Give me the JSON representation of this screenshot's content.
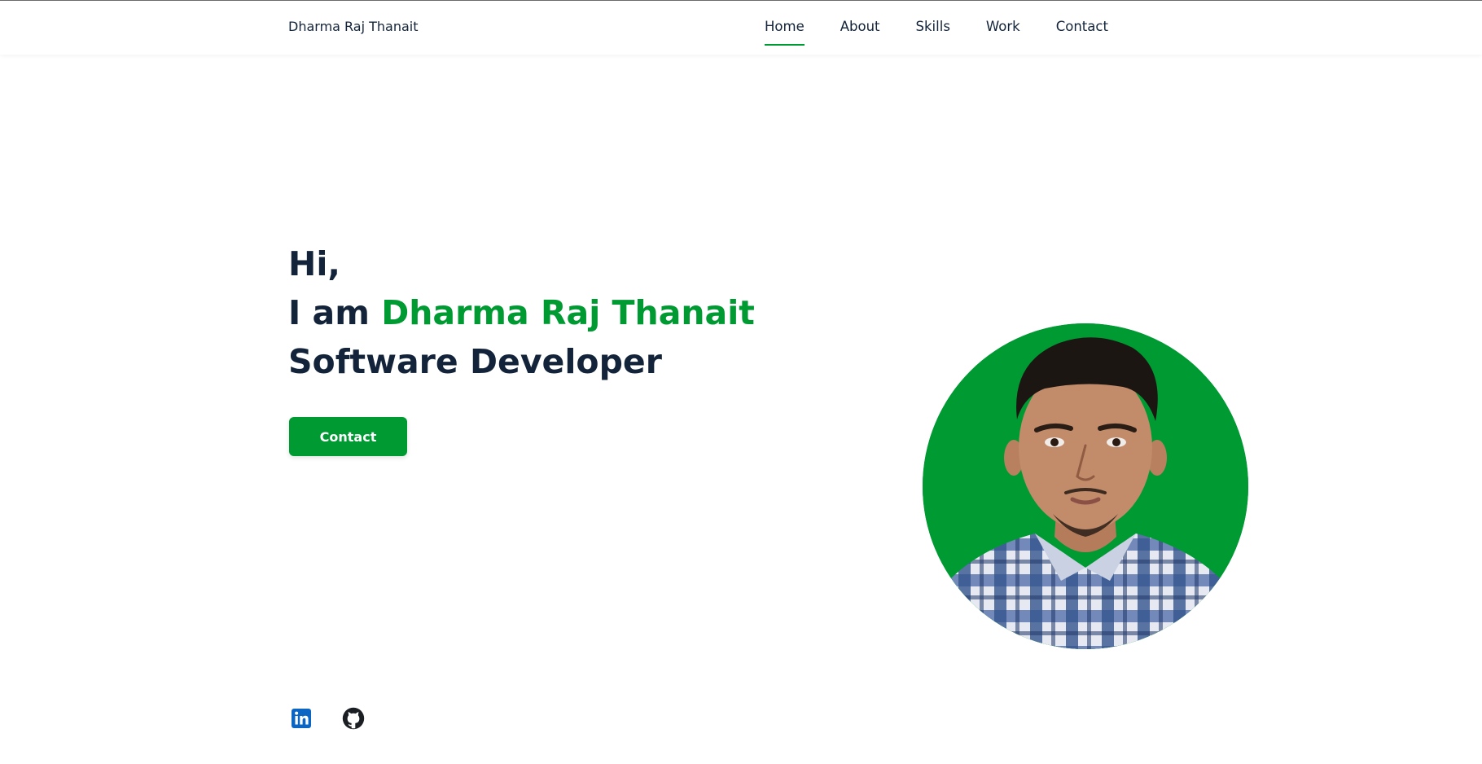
{
  "site": {
    "brand": "Dharma Raj Thanait"
  },
  "nav": {
    "items": [
      {
        "label": "Home",
        "active": true
      },
      {
        "label": "About",
        "active": false
      },
      {
        "label": "Skills",
        "active": false
      },
      {
        "label": "Work",
        "active": false
      },
      {
        "label": "Contact",
        "active": false
      }
    ]
  },
  "hero": {
    "greeting": "Hi,",
    "intro": "I am ",
    "name": "Dharma Raj Thanait",
    "role": "Software Developer",
    "contact_label": "Contact"
  },
  "social": [
    {
      "icon": "linkedin-icon"
    },
    {
      "icon": "github-icon"
    }
  ],
  "colors": {
    "accent": "#009a33",
    "text": "#13243a",
    "linkedin": "#0a66c2",
    "shirt_blue": "#35558f"
  },
  "portrait": {
    "subject": "profile photo of Dharma Raj Thanait"
  }
}
